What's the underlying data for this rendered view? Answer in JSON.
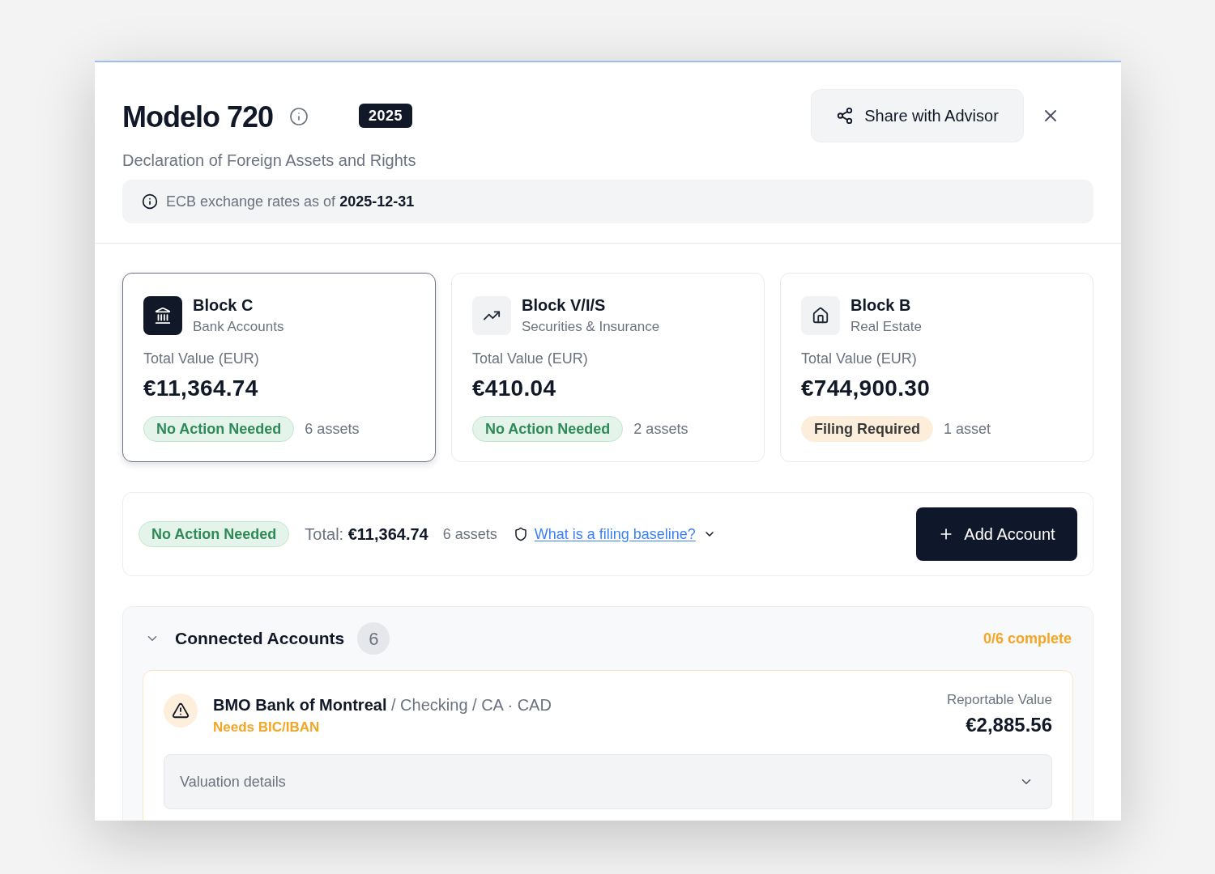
{
  "dialog": {
    "title": "Modelo 720",
    "year_badge": "2025",
    "subtitle": "Declaration of Foreign Assets and Rights",
    "share_button": "Share with Advisor",
    "notice": "ECB exchange rates as of **2025-12-31**"
  },
  "blocks": [
    {
      "kind": "bank",
      "title": "Block C",
      "subtitle": "Bank Accounts",
      "value_label": "Total Value (EUR)",
      "value": "€11,364.74",
      "status": {
        "kind": "ok",
        "label": "No Action Needed"
      },
      "count": "6 assets",
      "selected": true
    },
    {
      "kind": "securities",
      "title": "Block V/I/S",
      "subtitle": "Securities & Insurance",
      "value_label": "Total Value (EUR)",
      "value": "€410.04",
      "status": {
        "kind": "ok",
        "label": "No Action Needed"
      },
      "count": "2 assets",
      "selected": false
    },
    {
      "kind": "real_estate",
      "title": "Block B",
      "subtitle": "Real Estate",
      "value_label": "Total Value (EUR)",
      "value": "€744,900.30",
      "status": {
        "kind": "filing",
        "label": "Filing Required"
      },
      "count": "1 asset",
      "selected": false
    }
  ],
  "summary": {
    "status": {
      "kind": "ok",
      "label": "No Action Needed"
    },
    "total": "Total: **€11,364.74**",
    "count": "6 assets",
    "help_link": "What is a filing baseline?",
    "add_button": "Add Account"
  },
  "connected_accounts": {
    "title": "Connected Accounts",
    "count": "6",
    "progress": "0/6 complete",
    "expanded": true,
    "accounts": [
      {
        "kind": "warning",
        "name": "**BMO Bank of Montreal** / Checking / CA · CAD",
        "issue": "Needs BIC/IBAN",
        "value_label": "Reportable Value",
        "value": "€2,885.56",
        "details": {
          "label": "Valuation details",
          "expanded": false
        }
      }
    ]
  }
}
